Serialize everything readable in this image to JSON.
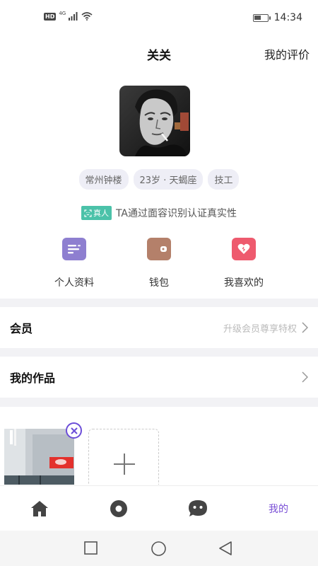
{
  "status_bar": {
    "network_badge": "HD",
    "network_type": "4G",
    "time": "14:34",
    "battery_level": 0.45,
    "icons": [
      "signal-icon",
      "wifi-icon",
      "battery-icon"
    ]
  },
  "header": {
    "title": "关关",
    "right_link": "我的评价"
  },
  "profile": {
    "avatar_alt": "avatar",
    "tags": [
      "常州钟楼",
      "23岁 · 天蝎座",
      "技工"
    ],
    "verify_badge": "真人",
    "verify_text": "TA通过面容识别认证真实性"
  },
  "quick_actions": [
    {
      "label": "个人资料",
      "icon": "profile-card-icon",
      "color": "#8e7fd0"
    },
    {
      "label": "钱包",
      "icon": "wallet-icon",
      "color": "#b4806a"
    },
    {
      "label": "我喜欢的",
      "icon": "heart-icon",
      "color": "#ee5a6e"
    }
  ],
  "rows": {
    "membership": {
      "label": "会员",
      "hint": "升级会员尊享特权"
    },
    "my_works": {
      "label": "我的作品"
    }
  },
  "works": {
    "remove_icon": "close-icon",
    "add_icon": "plus-icon"
  },
  "tabbar": {
    "tabs": [
      {
        "icon": "home-icon",
        "label": ""
      },
      {
        "icon": "discover-icon",
        "label": ""
      },
      {
        "icon": "chat-icon",
        "label": ""
      },
      {
        "icon": "",
        "label": "我的"
      }
    ],
    "active_color": "#7a4fd6"
  },
  "nav": {
    "buttons": [
      "recent-apps-icon",
      "home-circle-icon",
      "back-icon"
    ]
  }
}
